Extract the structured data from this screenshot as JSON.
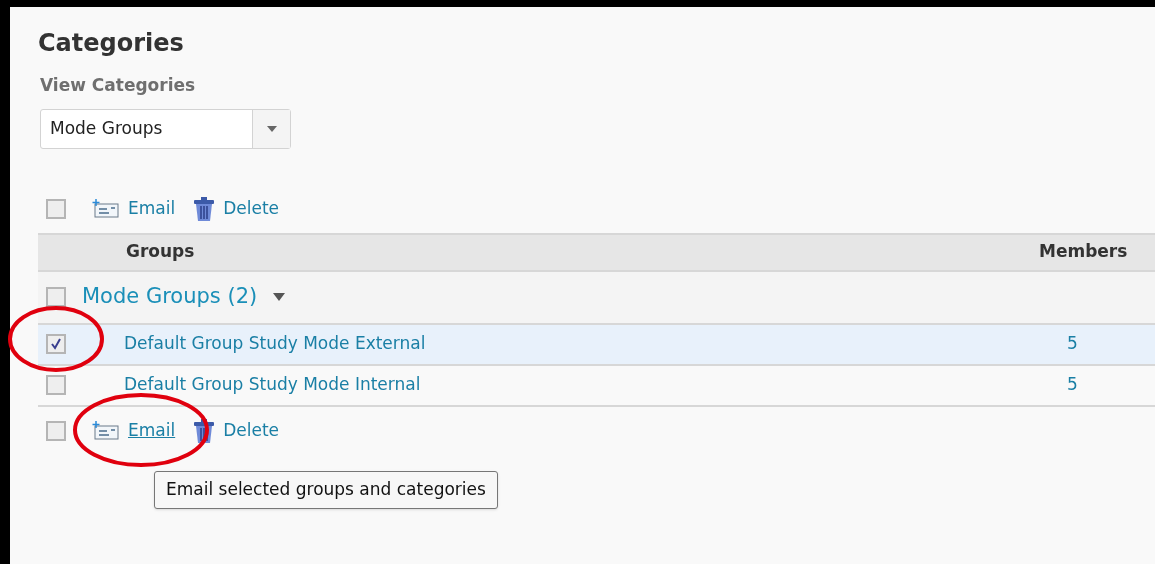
{
  "title": "Categories",
  "view": {
    "label": "View Categories",
    "value": "Mode Groups"
  },
  "top_toolbar": {
    "checked": false,
    "actions": [
      {
        "kind": "email",
        "label": "Email",
        "hovered": false
      },
      {
        "kind": "delete",
        "label": "Delete",
        "hovered": false
      }
    ]
  },
  "table": {
    "columns": [
      "Groups",
      "Members"
    ],
    "category": {
      "label": "Mode Groups (2)",
      "checked": false,
      "expanded": true
    },
    "rows": [
      {
        "name": "Default Group Study Mode External",
        "members": "5",
        "checked": true,
        "selected": true
      },
      {
        "name": "Default Group Study Mode Internal",
        "members": "5",
        "checked": false,
        "selected": false
      }
    ]
  },
  "bottom_toolbar": {
    "checked": false,
    "actions": [
      {
        "kind": "email",
        "label": "Email",
        "hovered": true
      },
      {
        "kind": "delete",
        "label": "Delete",
        "hovered": false
      }
    ]
  },
  "tooltip": "Email selected groups and categories"
}
